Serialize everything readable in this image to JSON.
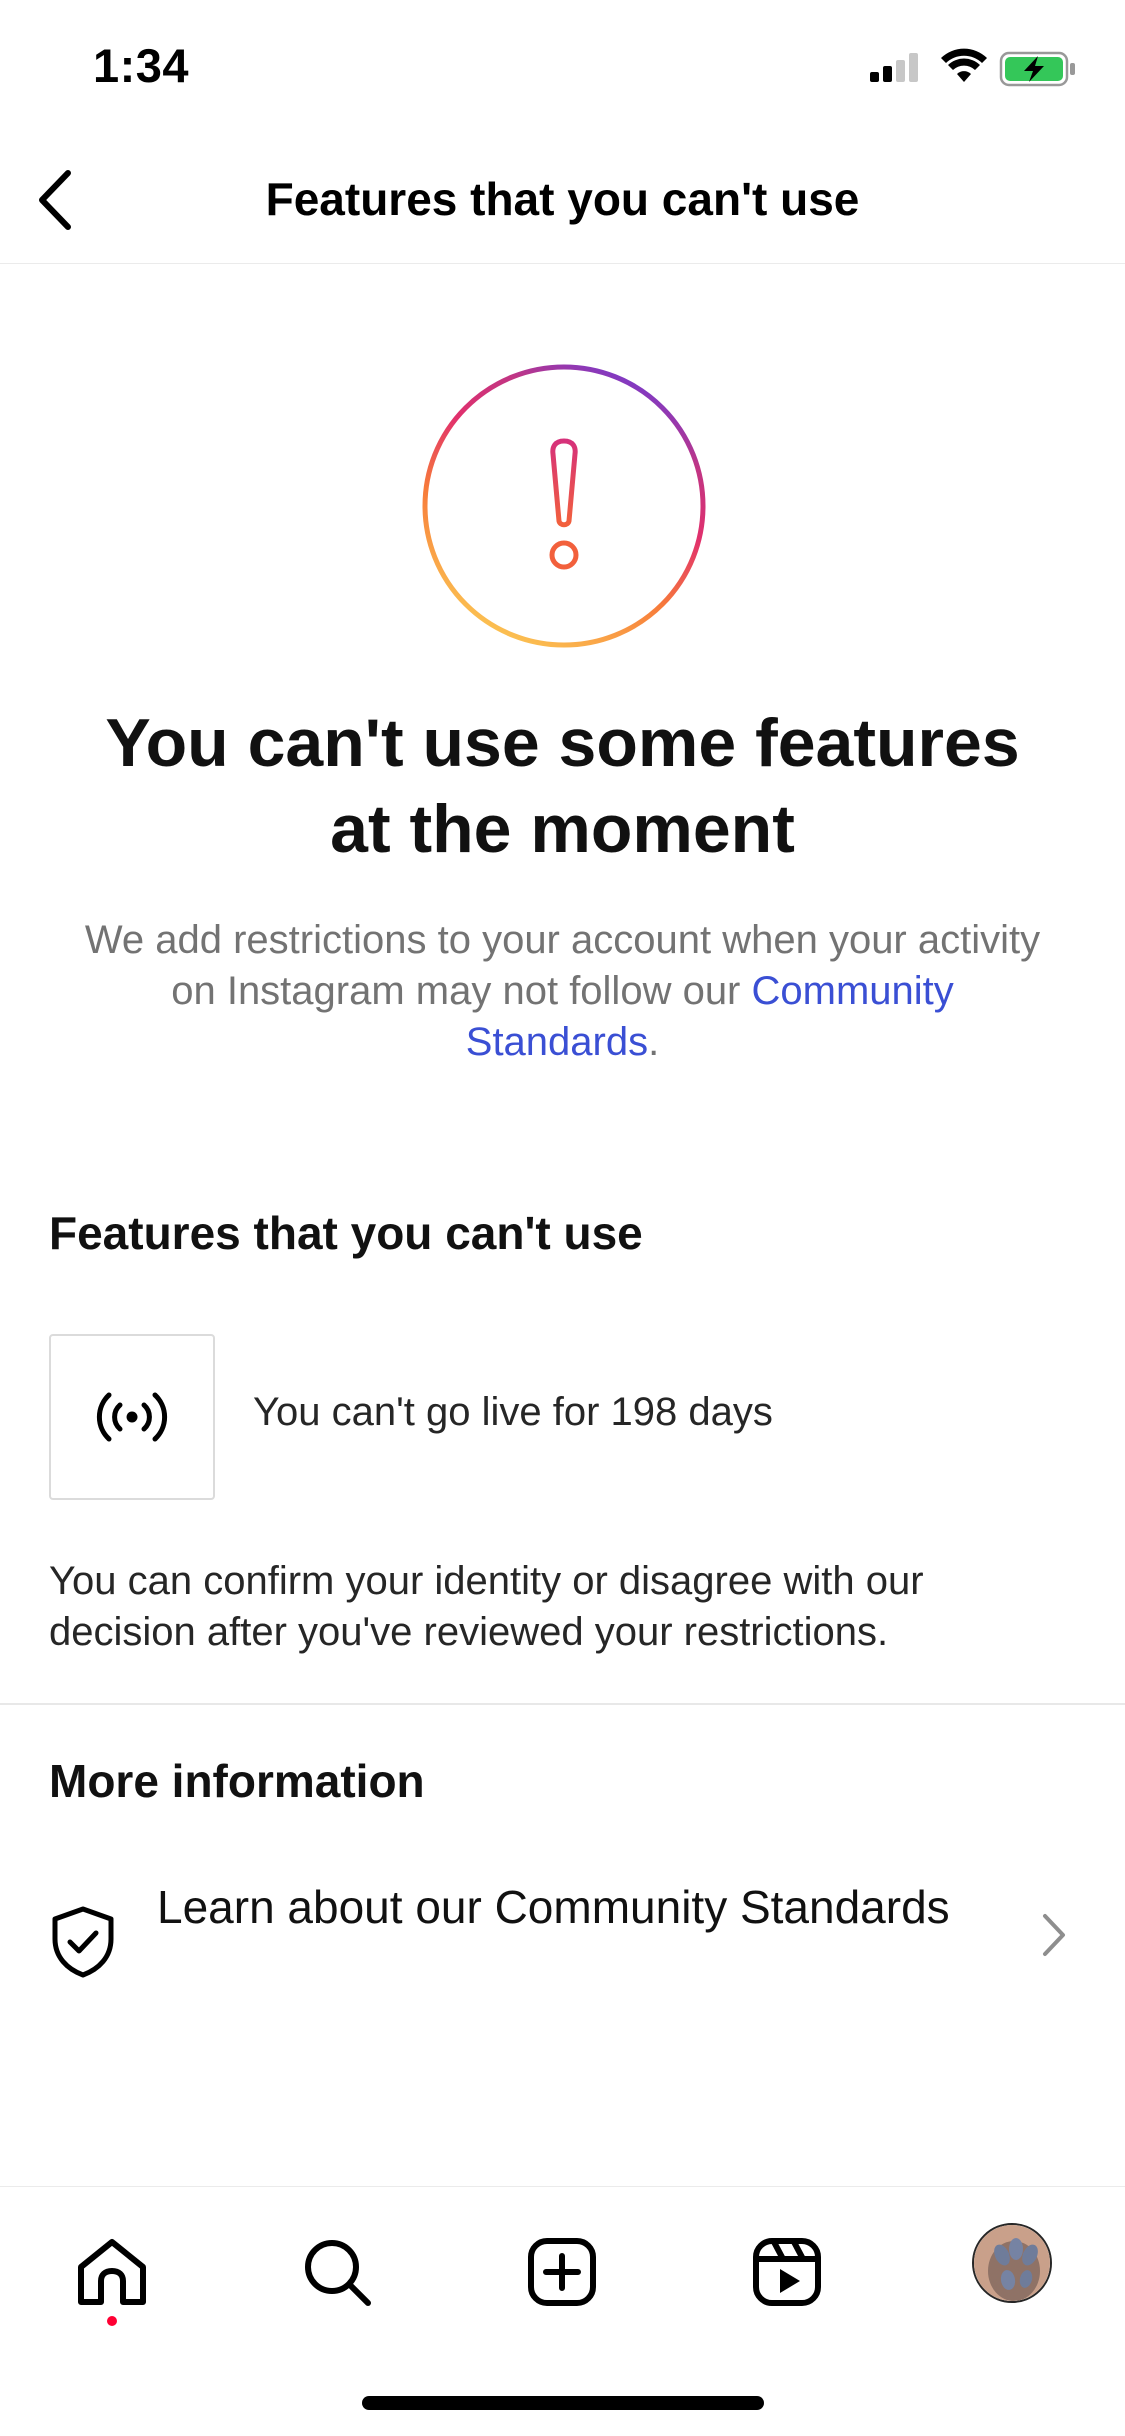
{
  "status_bar": {
    "time": "1:34"
  },
  "nav": {
    "title": "Features that you can't use",
    "back_icon": "chevron-left-icon"
  },
  "hero": {
    "icon": "alert-circle-icon",
    "headline_line1": "You can't use some features",
    "headline_line2": "at the moment",
    "description": "We add restrictions to your account when your activity on Instagram may not follow our",
    "link_text": "Community Standards",
    "period": "."
  },
  "features_section": {
    "title": "Features that you can't use",
    "items": [
      {
        "icon": "live-broadcast-icon",
        "text": "You can't go live for 198 days"
      }
    ],
    "note": "You can confirm your identity or disagree with our decision after you've reviewed your restrictions."
  },
  "more_info": {
    "title": "More information",
    "row_label": "Learn about our Community Standards",
    "row_icon": "shield-check-icon"
  },
  "tab_bar": {
    "items": [
      "home-icon",
      "search-icon",
      "create-icon",
      "reels-icon",
      "profile-avatar"
    ],
    "active": "home-icon"
  },
  "colors": {
    "link": "#3a4fd4",
    "notification_dot": "#ff0033",
    "secondary_text": "#737373"
  }
}
